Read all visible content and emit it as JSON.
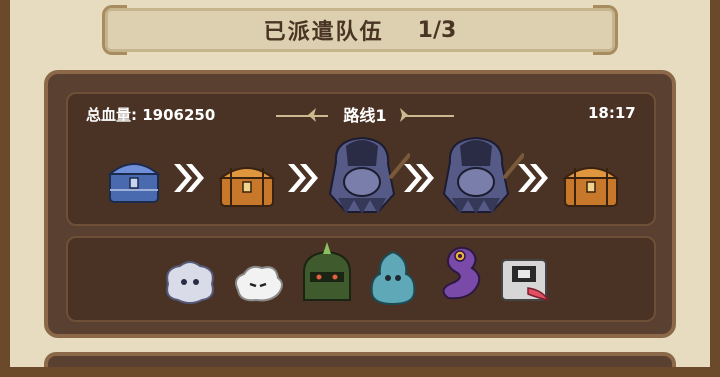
{
  "header": {
    "title": "已派遣队伍",
    "count": "1/3"
  },
  "route": {
    "hp_text": "总血量: 1906250",
    "route_label": "路线1",
    "time": "18:17",
    "nodes": [
      {
        "kind": "chest",
        "variant": "blue",
        "icon": "chest-blue-icon"
      },
      {
        "kind": "chest",
        "variant": "orange",
        "icon": "chest-orange-icon"
      },
      {
        "kind": "enemy",
        "variant": "hooded-brute",
        "icon": "hooded-brute-icon"
      },
      {
        "kind": "enemy",
        "variant": "hooded-brute",
        "icon": "hooded-brute-icon"
      },
      {
        "kind": "chest",
        "variant": "orange",
        "icon": "chest-orange-icon"
      }
    ]
  },
  "team": {
    "members": [
      {
        "icon": "white-fluffy-creature-icon",
        "color": "#d9dbe8"
      },
      {
        "icon": "cloud-creature-icon",
        "color": "#f2f2f2"
      },
      {
        "icon": "green-armor-creature-icon",
        "color": "#3f5a2c"
      },
      {
        "icon": "teal-blob-creature-icon",
        "color": "#5fa8b8"
      },
      {
        "icon": "purple-snake-creature-icon",
        "color": "#7a4aa8"
      },
      {
        "icon": "robot-box-creature-icon",
        "color": "#d6d6d6"
      }
    ]
  },
  "colors": {
    "frame": "#6b4a2c",
    "panel": "#5a4030",
    "parchment": "#e8dcc0",
    "accent_gold": "#cdb890"
  }
}
